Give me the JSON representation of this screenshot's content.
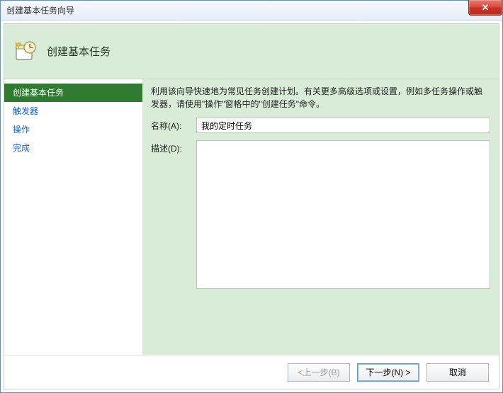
{
  "window": {
    "title": "创建基本任务向导",
    "close_glyph": "✕"
  },
  "header": {
    "title": "创建基本任务"
  },
  "sidebar": {
    "items": [
      {
        "label": "创建基本任务",
        "selected": true
      },
      {
        "label": "触发器",
        "selected": false
      },
      {
        "label": "操作",
        "selected": false
      },
      {
        "label": "完成",
        "selected": false
      }
    ]
  },
  "main": {
    "intro": "利用该向导快速地为常见任务创建计划。有关更多高级选项或设置，例如多任务操作或触发器，请使用\"操作\"窗格中的\"创建任务\"命令。",
    "name_label": "名称(A):",
    "name_value": "我的定时任务",
    "desc_label": "描述(D):",
    "desc_value": ""
  },
  "footer": {
    "back_label": "<上一步(B)",
    "next_label": "下一步(N) >",
    "cancel_label": "取消"
  }
}
